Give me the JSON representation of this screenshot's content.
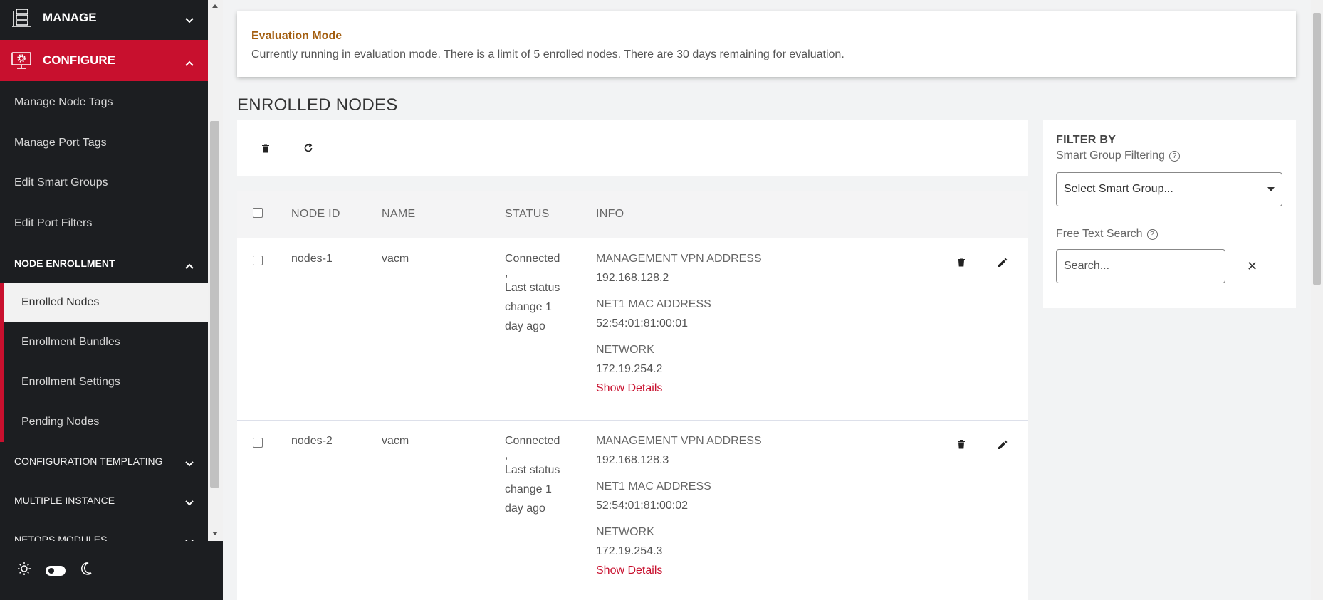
{
  "sidebar": {
    "manage": {
      "label": "MANAGE",
      "icon": "server-stack-icon"
    },
    "configure": {
      "label": "CONFIGURE",
      "icon": "monitor-gear-icon"
    },
    "configure_items": [
      {
        "label": "Manage Node Tags"
      },
      {
        "label": "Manage Port Tags"
      },
      {
        "label": "Edit Smart Groups"
      },
      {
        "label": "Edit Port Filters"
      }
    ],
    "node_enrollment": {
      "label": "NODE ENROLLMENT",
      "items": [
        {
          "label": "Enrolled Nodes",
          "active": true
        },
        {
          "label": "Enrollment Bundles"
        },
        {
          "label": "Enrollment Settings"
        },
        {
          "label": "Pending Nodes"
        }
      ]
    },
    "configuration_templating": {
      "label": "CONFIGURATION TEMPLATING"
    },
    "multiple_instance": {
      "label": "MULTIPLE INSTANCE"
    },
    "netops_modules": {
      "label": "NETOPS MODULES"
    }
  },
  "theme": {
    "light_icon": "sun-icon",
    "dark_icon": "moon-icon"
  },
  "banner": {
    "title": "Evaluation Mode",
    "message": "Currently running in evaluation mode. There is a limit of 5 enrolled nodes. There are 30 days remaining for evaluation."
  },
  "page": {
    "title": "ENROLLED NODES"
  },
  "table": {
    "headers": {
      "node_id": "NODE ID",
      "name": "NAME",
      "status": "STATUS",
      "info": "INFO"
    },
    "rows": [
      {
        "node_id": "nodes-1",
        "name": "vacm",
        "status": [
          "Connected",
          ",",
          "Last status",
          "change 1",
          "day ago"
        ],
        "info": [
          {
            "label": "MANAGEMENT VPN ADDRESS",
            "value": "192.168.128.2"
          },
          {
            "label": "NET1 MAC ADDRESS",
            "value": "52:54:01:81:00:01"
          },
          {
            "label": "NETWORK",
            "value": "172.19.254.2"
          }
        ],
        "details_label": "Show Details"
      },
      {
        "node_id": "nodes-2",
        "name": "vacm",
        "status": [
          "Connected",
          ",",
          "Last status",
          "change 1",
          "day ago"
        ],
        "info": [
          {
            "label": "MANAGEMENT VPN ADDRESS",
            "value": "192.168.128.3"
          },
          {
            "label": "NET1 MAC ADDRESS",
            "value": "52:54:01:81:00:02"
          },
          {
            "label": "NETWORK",
            "value": "172.19.254.3"
          }
        ],
        "details_label": "Show Details"
      }
    ]
  },
  "filter": {
    "title": "FILTER BY",
    "smart_group_label": "Smart Group Filtering",
    "smart_group_value": "Select Smart Group...",
    "free_text_label": "Free Text Search",
    "search_placeholder": "Search..."
  },
  "colors": {
    "accent": "#c8102e",
    "sidebar_bg": "#1c1e21",
    "banner_title": "#a35e10"
  }
}
